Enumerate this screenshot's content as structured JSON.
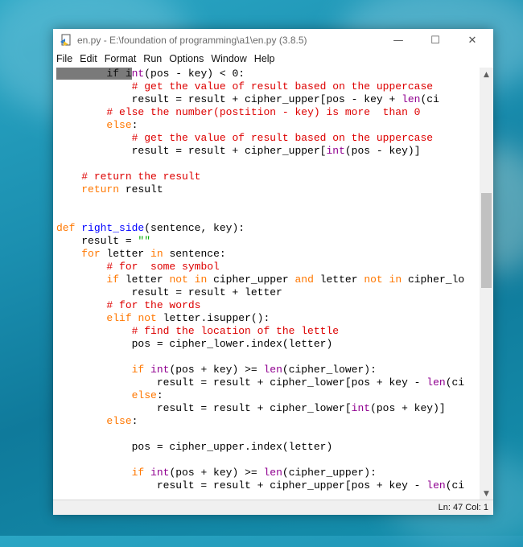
{
  "window": {
    "title": "en.py - E:\\foundation of programming\\a1\\en.py (3.8.5)",
    "controls": {
      "minimize": "—",
      "maximize": "☐",
      "close": "✕"
    }
  },
  "menu": {
    "items": [
      "File",
      "Edit",
      "Format",
      "Run",
      "Options",
      "Window",
      "Help"
    ]
  },
  "code_lines": [
    "        if int(pos - key) < 0:",
    "            # get the value of result based on the uppercase",
    "            result = result + cipher_upper[pos - key + len(ci",
    "        # else the number(postition - key) is more  than 0",
    "        else:",
    "            # get the value of result based on the uppercase",
    "            result = result + cipher_upper[int(pos - key)]",
    "",
    "    # return the result",
    "    return result",
    "",
    "",
    "def right_side(sentence, key):",
    "    result = \"\"",
    "    for letter in sentence:",
    "        # for  some symbol",
    "        if letter not in cipher_upper and letter not in cipher_lo",
    "            result = result + letter",
    "        # for the words",
    "        elif not letter.isupper():",
    "            # find the location of the lettle",
    "            pos = cipher_lower.index(letter)",
    "",
    "            if int(pos + key) >= len(cipher_lower):",
    "                result = result + cipher_lower[pos + key - len(ci",
    "            else:",
    "                result = result + cipher_lower[int(pos + key)]",
    "        else:",
    "",
    "            pos = cipher_upper.index(letter)",
    "",
    "            if int(pos + key) >= len(cipher_upper):",
    "                result = result + cipher_upper[pos + key - len(ci"
  ],
  "status": {
    "line_col": "Ln: 47  Col: 1"
  },
  "colors": {
    "keyword": "#ff7700",
    "builtin": "#900090",
    "comment": "#dd0000",
    "string": "#00aa00",
    "definition": "#0000ff",
    "desktop": "#1b8fb0"
  }
}
